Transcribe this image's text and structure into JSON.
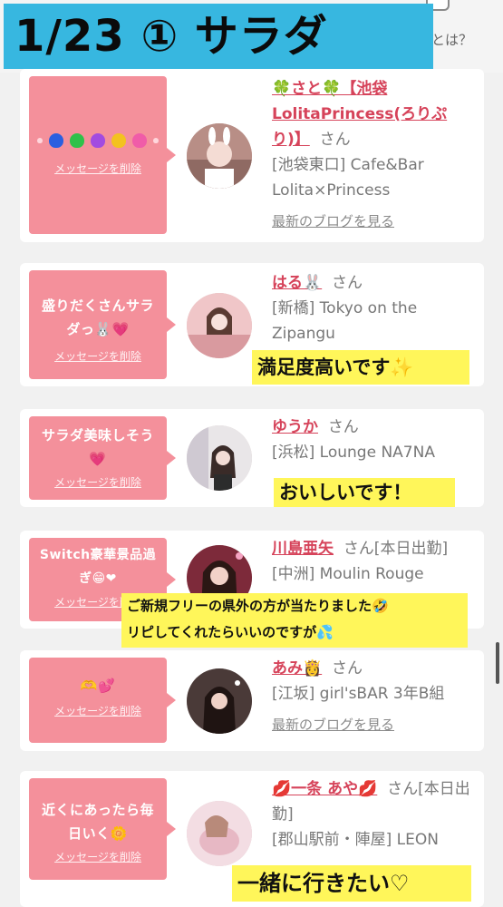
{
  "banner": {
    "title": "1/23 ① サラダ"
  },
  "top_right": {
    "text": "とは？"
  },
  "delete_label": "メッセージを削除",
  "blog_label": "最新のブログを見る",
  "messages": [
    {
      "text": "",
      "name": "🍀さと🍀【池袋LolitaPrincess(ろりぷり)】",
      "san": "さん",
      "shop": "[池袋東口] Cafe&Bar Lolita×Princess",
      "blog": "最新のブログを見る"
    },
    {
      "text": "盛りだくさんサラダっ🐰💗",
      "name": "はる🐰",
      "san": "さん",
      "shop": "[新橋] Tokyo on the Zipangu",
      "caption": "満足度高いです✨"
    },
    {
      "text": "サラダ美味しそう💗",
      "name": "ゆうか",
      "san": "さん",
      "shop": "[浜松] Lounge NA7NA",
      "caption": "おいしいです！"
    },
    {
      "text": "Switch豪華景品過ぎ😁❤",
      "name": "川島亜矢",
      "san": "さん[本日出勤]",
      "shop": "[中洲] Moulin Rouge",
      "caption_line1": "ご新規フリーの県外の方が当たりました🤣",
      "caption_line2": "リピしてくれたらいいのですが💦"
    },
    {
      "text": "🫶💕",
      "name": "あみ👸",
      "san": "さん",
      "shop": "[江坂] girl'sBAR 3年B組",
      "blog": "最新のブログを見る"
    },
    {
      "text": "近くにあったら毎日いく🌼",
      "name": "💋一条 あや💋",
      "san": "さん[本日出勤]",
      "shop": "[郡山駅前・陣屋] LEON",
      "caption": "一緒に行きたい♡"
    }
  ],
  "colors": {
    "bubble": "#f4909b",
    "name": "#d6435a",
    "banner": "#37b7e0",
    "highlight": "#fff65a"
  }
}
